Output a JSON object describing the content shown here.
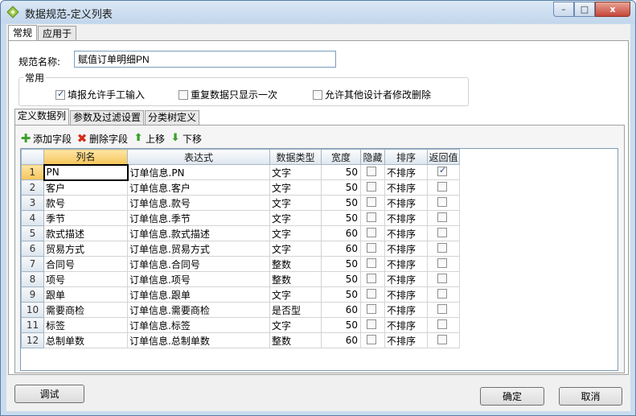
{
  "window": {
    "title": "数据规范-定义列表",
    "icon": "diamond-app-icon",
    "minimize": "–",
    "maximize": "□",
    "close": "x"
  },
  "top_tabs": [
    "常规",
    "应用于"
  ],
  "form": {
    "name_label": "规范名称:",
    "name_value": "赋值订单明细PN"
  },
  "group": {
    "title": "常用",
    "options": [
      {
        "label": "填报允许手工输入",
        "checked": true
      },
      {
        "label": "重复数据只显示一次",
        "checked": false
      },
      {
        "label": "允许其他设计者修改删除",
        "checked": false
      }
    ]
  },
  "inner_tabs": [
    "定义数据列",
    "参数及过滤设置",
    "分类树定义"
  ],
  "toolbar": {
    "add": "添加字段",
    "delete": "删除字段",
    "up": "上移",
    "down": "下移",
    "add_glyph": "✚",
    "delete_glyph": "✖",
    "up_glyph": "⬆",
    "down_glyph": "⬇"
  },
  "table": {
    "columns": [
      "列名",
      "表达式",
      "数据类型",
      "宽度",
      "隐藏",
      "排序",
      "返回值"
    ],
    "rows": [
      {
        "n": "1",
        "name": "PN",
        "expr": "订单信息.PN",
        "type": "文字",
        "width": "50",
        "hidden": false,
        "sort": "不排序",
        "ret": true
      },
      {
        "n": "2",
        "name": "客户",
        "expr": "订单信息.客户",
        "type": "文字",
        "width": "50",
        "hidden": false,
        "sort": "不排序",
        "ret": false
      },
      {
        "n": "3",
        "name": "款号",
        "expr": "订单信息.款号",
        "type": "文字",
        "width": "50",
        "hidden": false,
        "sort": "不排序",
        "ret": false
      },
      {
        "n": "4",
        "name": "季节",
        "expr": "订单信息.季节",
        "type": "文字",
        "width": "50",
        "hidden": false,
        "sort": "不排序",
        "ret": false
      },
      {
        "n": "5",
        "name": "款式描述",
        "expr": "订单信息.款式描述",
        "type": "文字",
        "width": "60",
        "hidden": false,
        "sort": "不排序",
        "ret": false
      },
      {
        "n": "6",
        "name": "贸易方式",
        "expr": "订单信息.贸易方式",
        "type": "文字",
        "width": "60",
        "hidden": false,
        "sort": "不排序",
        "ret": false
      },
      {
        "n": "7",
        "name": "合同号",
        "expr": "订单信息.合同号",
        "type": "整数",
        "width": "50",
        "hidden": false,
        "sort": "不排序",
        "ret": false
      },
      {
        "n": "8",
        "name": "项号",
        "expr": "订单信息.项号",
        "type": "整数",
        "width": "50",
        "hidden": false,
        "sort": "不排序",
        "ret": false
      },
      {
        "n": "9",
        "name": "跟单",
        "expr": "订单信息.跟单",
        "type": "文字",
        "width": "50",
        "hidden": false,
        "sort": "不排序",
        "ret": false
      },
      {
        "n": "10",
        "name": "需要商检",
        "expr": "订单信息.需要商检",
        "type": "是否型",
        "width": "60",
        "hidden": false,
        "sort": "不排序",
        "ret": false
      },
      {
        "n": "11",
        "name": "标签",
        "expr": "订单信息.标签",
        "type": "文字",
        "width": "50",
        "hidden": false,
        "sort": "不排序",
        "ret": false
      },
      {
        "n": "12",
        "name": "总制单数",
        "expr": "订单信息.总制单数",
        "type": "整数",
        "width": "60",
        "hidden": false,
        "sort": "不排序",
        "ret": false
      }
    ]
  },
  "buttons": {
    "debug": "调试",
    "ok": "确定",
    "cancel": "取消"
  }
}
